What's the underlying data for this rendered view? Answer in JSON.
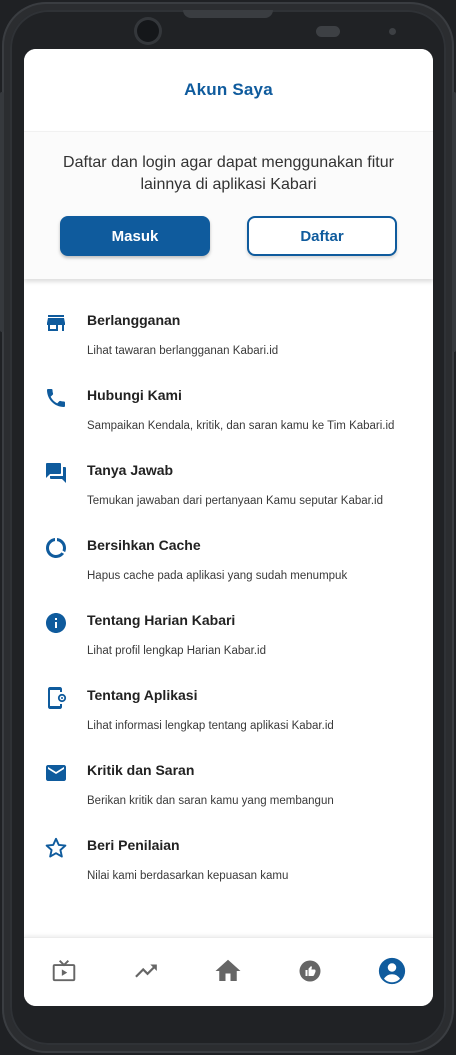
{
  "header": {
    "title": "Akun Saya"
  },
  "login": {
    "message": "Daftar dan login agar dapat menggunakan fitur lainnya di aplikasi Kabari",
    "masuk_label": "Masuk",
    "daftar_label": "Daftar"
  },
  "menu": [
    {
      "title": "Berlangganan",
      "subtitle": "Lihat tawaran berlangganan Kabari.id",
      "icon": "store-icon"
    },
    {
      "title": "Hubungi Kami",
      "subtitle": "Sampaikan Kendala, kritik, dan saran kamu ke Tim Kabari.id",
      "icon": "phone-icon"
    },
    {
      "title": "Tanya Jawab",
      "subtitle": "Temukan jawaban dari pertanyaan Kamu seputar Kabar.id",
      "icon": "chat-icon"
    },
    {
      "title": "Bersihkan Cache",
      "subtitle": "Hapus cache pada aplikasi yang sudah menumpuk",
      "icon": "donut-icon"
    },
    {
      "title": "Tentang Harian Kabari",
      "subtitle": "Lihat profil lengkap Harian Kabar.id",
      "icon": "info-icon"
    },
    {
      "title": "Tentang Aplikasi",
      "subtitle": "Lihat informasi lengkap tentang aplikasi Kabar.id",
      "icon": "phone-settings-icon"
    },
    {
      "title": "Kritik dan Saran",
      "subtitle": "Berikan kritik dan saran kamu yang membangun",
      "icon": "mail-icon"
    },
    {
      "title": "Beri Penilaian",
      "subtitle": "Nilai kami berdasarkan kepuasan kamu",
      "icon": "star-icon"
    }
  ],
  "bottom_nav": [
    {
      "icon": "tv-icon",
      "active": false
    },
    {
      "icon": "trending-icon",
      "active": false
    },
    {
      "icon": "home-icon",
      "active": false
    },
    {
      "icon": "thumb-icon",
      "active": false
    },
    {
      "icon": "account-icon",
      "active": true
    }
  ],
  "colors": {
    "primary": "#0f5b9d",
    "icon_gray": "#666666",
    "text": "#222222",
    "frame": "#2b2d30"
  }
}
